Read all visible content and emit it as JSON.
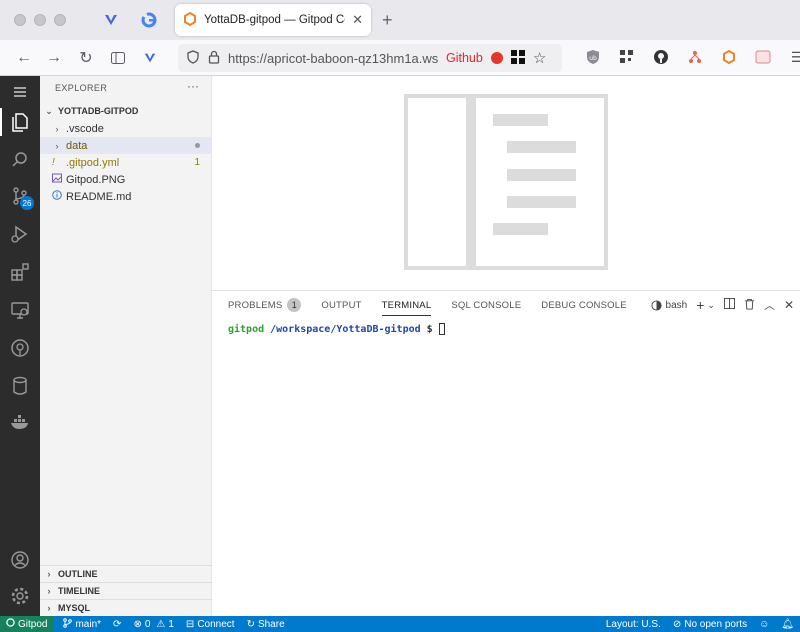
{
  "browser": {
    "active_tab_title": "YottaDB-gitpod — Gitpod Code",
    "url": "https://apricot-baboon-qz13hm1a.ws-",
    "url_extension_label": "Github",
    "pinned_icons": [
      "yottadb-icon",
      "google-icon"
    ]
  },
  "sidebar": {
    "header": "EXPLORER",
    "root_folder": "YOTTADB-GITPOD",
    "files": [
      {
        "label": ".vscode",
        "type": "folder"
      },
      {
        "label": "data",
        "type": "folder"
      },
      {
        "label": ".gitpod.yml",
        "type": "file",
        "badge": "1"
      },
      {
        "label": "Gitpod.PNG",
        "type": "image"
      },
      {
        "label": "README.md",
        "type": "info"
      }
    ],
    "bottom_sections": [
      "OUTLINE",
      "TIMELINE",
      "MYSQL"
    ]
  },
  "activity": {
    "scm_badge": "26"
  },
  "panel": {
    "tabs": [
      {
        "label": "PROBLEMS",
        "badge": "1"
      },
      {
        "label": "OUTPUT"
      },
      {
        "label": "TERMINAL"
      },
      {
        "label": "SQL CONSOLE"
      },
      {
        "label": "DEBUG CONSOLE"
      }
    ],
    "shell": "bash",
    "terminal": {
      "host": "gitpod",
      "path": "/workspace/YottaDB-gitpod",
      "prompt": "$"
    }
  },
  "status": {
    "remote": "Gitpod",
    "branch": "main*",
    "errors": "0",
    "warnings": "1",
    "connect": "Connect",
    "share": "Share",
    "layout": "Layout: U.S.",
    "ports": "No open ports"
  },
  "colors": {
    "statusbar": "#007acc",
    "remote": "#16825d",
    "activitybar": "#2c2c2c",
    "sidebar": "#f3f3f3"
  }
}
